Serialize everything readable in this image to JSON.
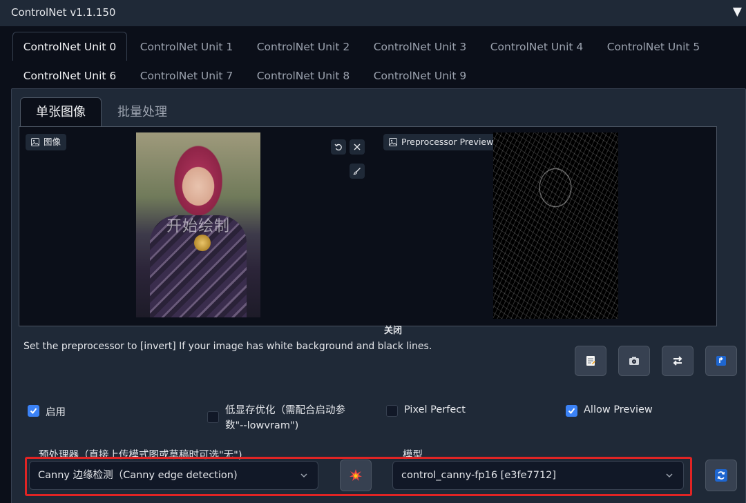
{
  "accordion": {
    "title": "ControlNet v1.1.150"
  },
  "unit_tabs": [
    "ControlNet Unit 0",
    "ControlNet Unit 1",
    "ControlNet Unit 2",
    "ControlNet Unit 3",
    "ControlNet Unit 4",
    "ControlNet Unit 5",
    "ControlNet Unit 6",
    "ControlNet Unit 7",
    "ControlNet Unit 8",
    "ControlNet Unit 9"
  ],
  "image_tabs": [
    "单张图像",
    "批量处理"
  ],
  "image_input": {
    "label": "图像",
    "watermark": "开始绘制"
  },
  "preprocessor_preview": {
    "label": "Preprocessor Preview"
  },
  "close_label": "关闭",
  "hint": "Set the preprocessor to [invert] If your image has white background and black lines.",
  "options": {
    "enable": {
      "label": "启用",
      "checked": true
    },
    "low_vram": {
      "label_line1": "低显存优化（需配合启动参",
      "label_line2": "数\"--lowvram\")",
      "checked": false
    },
    "pixel_perfect": {
      "label": "Pixel Perfect",
      "checked": false
    },
    "allow_preview": {
      "label": "Allow Preview",
      "checked": true
    }
  },
  "preprocessor": {
    "label": "预处理器（直接上传模式图或草稿时可选\"无\")",
    "value": "Canny 边缘检测（Canny edge detection)"
  },
  "model": {
    "label": "模型",
    "value": "control_canny-fp16 [e3fe7712]"
  },
  "colors": {
    "accent": "#3b82f6",
    "highlight": "#e02424",
    "background": "#0b0f19",
    "panel": "#1f2937"
  }
}
